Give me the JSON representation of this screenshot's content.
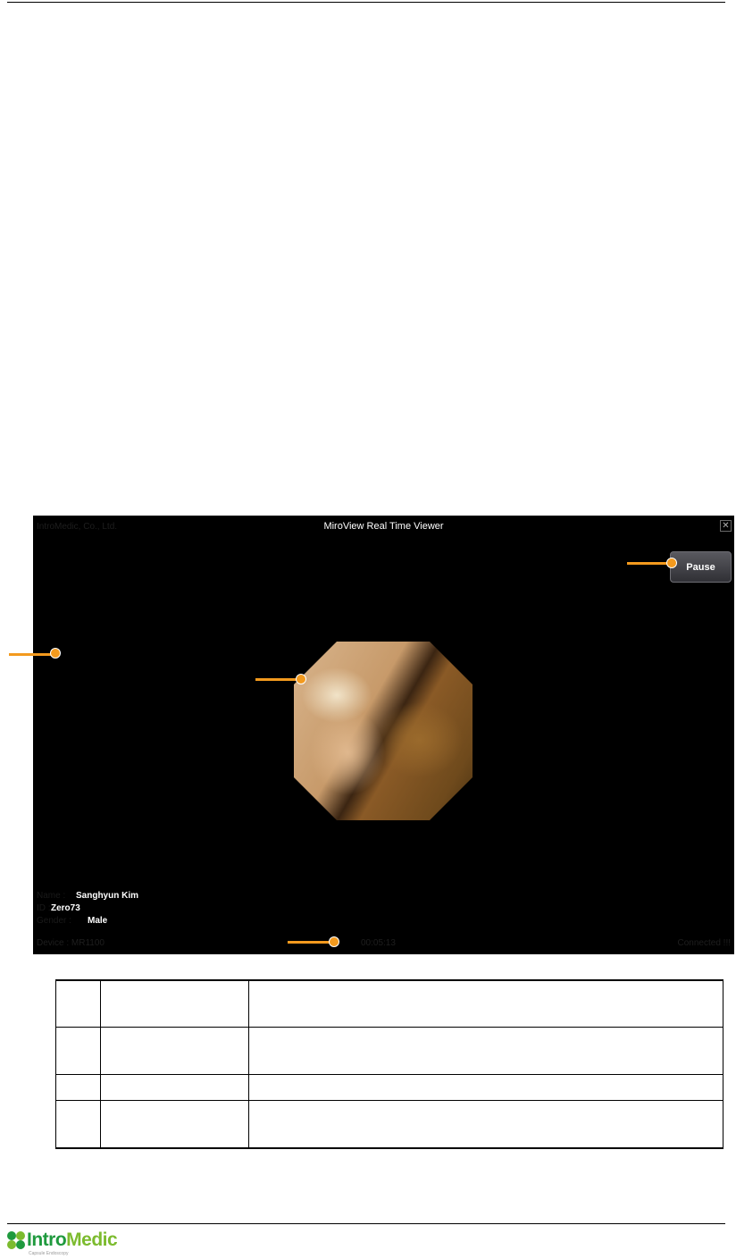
{
  "viewer": {
    "company": "IntroMedic, Co., Ltd.",
    "title": "MiroView Real Time Viewer",
    "close_icon": "close-icon",
    "pause_label": "Pause",
    "patient": {
      "name_label": "Name :",
      "name_value": "Sanghyun Kim",
      "id_label": "ID :",
      "id_value": "Zero73",
      "gender_label": "Gender :",
      "gender_value": "Male"
    },
    "device": "Device : MR1100",
    "elapsed_time": "00:05:13",
    "status": "Connected !!!"
  },
  "colors": {
    "callout": "#f39a1e",
    "viewer_background": "#000000",
    "logo_dark_green": "#1f9a3e",
    "logo_light_green": "#7cbb2e"
  },
  "table": {
    "rows": [
      {
        "num": "",
        "term": "",
        "description": ""
      },
      {
        "num": "",
        "term": "",
        "description": ""
      },
      {
        "num": "",
        "term": "",
        "description": ""
      },
      {
        "num": "",
        "term": "",
        "description": ""
      }
    ]
  },
  "footer": {
    "logo_intro": "Intro",
    "logo_medic": "Medic",
    "logo_tagline": "Capsule Endoscopy"
  }
}
